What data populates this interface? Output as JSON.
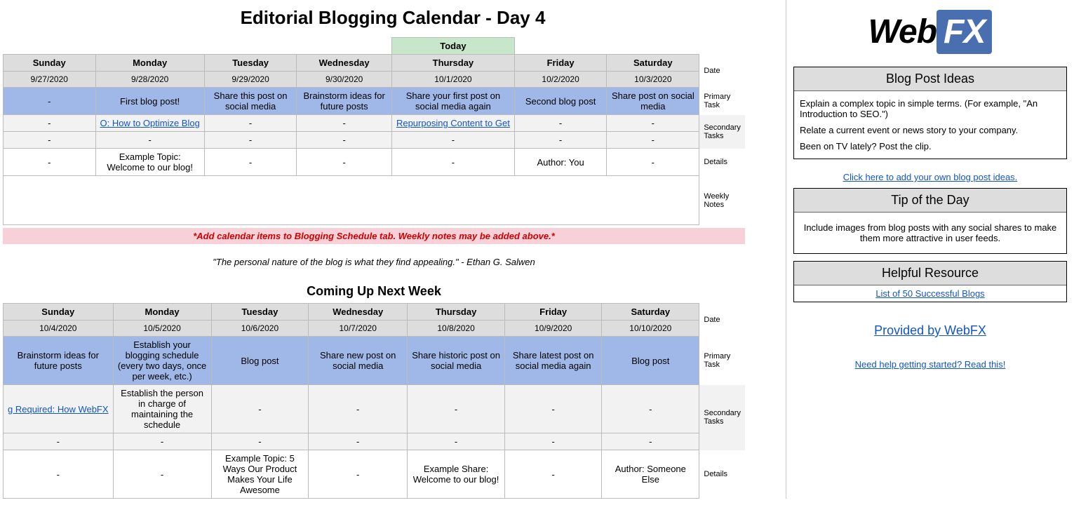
{
  "title": "Editorial Blogging Calendar - Day 4",
  "today_label": "Today",
  "days": [
    "Sunday",
    "Monday",
    "Tuesday",
    "Wednesday",
    "Thursday",
    "Friday",
    "Saturday"
  ],
  "row_labels": {
    "date": "Date",
    "primary": "Primary Task",
    "secondary": "Secondary Tasks",
    "details": "Details",
    "notes": "Weekly Notes"
  },
  "week1": {
    "dates": [
      "9/27/2020",
      "9/28/2020",
      "9/29/2020",
      "9/30/2020",
      "10/1/2020",
      "10/2/2020",
      "10/3/2020"
    ],
    "primary": [
      "-",
      "First blog post!",
      "Share this post on social media",
      "Brainstorm ideas for future posts",
      "Share your first post on social media again",
      "Second blog post",
      "Share post on social media"
    ],
    "secondary1": [
      "-",
      "O: How to Optimize Blog",
      "-",
      "-",
      "Repurposing Content to Get",
      "-",
      "-"
    ],
    "secondary1_link": [
      false,
      true,
      false,
      false,
      true,
      false,
      false
    ],
    "secondary2": [
      "-",
      "-",
      "-",
      "-",
      "-",
      "-",
      "-"
    ],
    "details": [
      "-",
      "Example Topic: Welcome to our blog!",
      "-",
      "-",
      "-",
      "Author: You",
      "-"
    ]
  },
  "hint": "*Add calendar items to Blogging Schedule tab. Weekly notes may be added above.*",
  "quote": "\"The personal nature of the blog is what they find appealing.\" - Ethan G. Salwen",
  "next_week_title": "Coming Up Next Week",
  "week2": {
    "dates": [
      "10/4/2020",
      "10/5/2020",
      "10/6/2020",
      "10/7/2020",
      "10/8/2020",
      "10/9/2020",
      "10/10/2020"
    ],
    "primary": [
      "Brainstorm ideas for future posts",
      "Establish your blogging schedule (every two days, once per week, etc.)",
      "Blog post",
      "Share new post on social media",
      "Share historic post on social media",
      "Share latest post on social media again",
      "Blog post"
    ],
    "secondary1": [
      "g Required: How WebFX",
      "Establish the person in charge of maintaining the schedule",
      "-",
      "-",
      "-",
      "-",
      "-"
    ],
    "secondary1_link": [
      true,
      false,
      false,
      false,
      false,
      false,
      false
    ],
    "secondary2": [
      "-",
      "-",
      "-",
      "-",
      "-",
      "-",
      "-"
    ],
    "details": [
      "-",
      "-",
      "Example Topic: 5 Ways Our Product Makes Your Life Awesome",
      "-",
      "Example Share: Welcome to our blog!",
      "-",
      "Author: Someone Else"
    ]
  },
  "logo": {
    "web": "Web",
    "fx": "FX"
  },
  "ideas_panel": {
    "title": "Blog Post Ideas",
    "items": [
      "Explain a complex topic in simple terms. (For example, \"An Introduction to SEO.\")",
      "Relate a current event or news story to your company.",
      "Been on TV lately? Post the clip."
    ],
    "add_link": "Click here to add your own blog post ideas."
  },
  "tip_panel": {
    "title": "Tip of the Day",
    "body": "Include images from blog posts with any social shares to make them more attractive in user feeds."
  },
  "resource_panel": {
    "title": "Helpful Resource",
    "link": "List of 50 Successful Blogs"
  },
  "provided_by": "Provided by WebFX",
  "help_link": "Need help getting started? Read this!"
}
